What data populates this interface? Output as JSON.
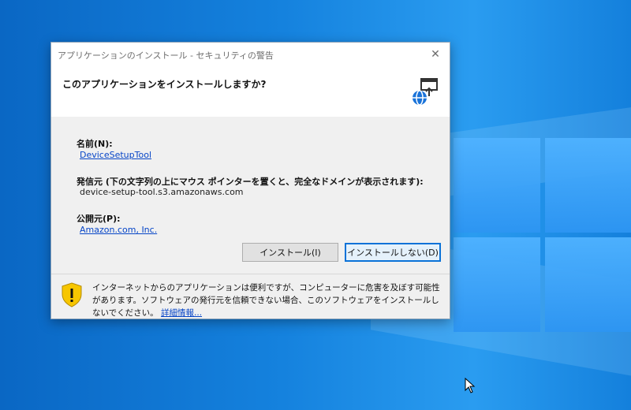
{
  "dialog": {
    "title": "アプリケーションのインストール - セキュリティの警告",
    "close_glyph": "✕",
    "question": "このアプリケーションをインストールしますか?",
    "name_label": "名前(N):",
    "name_value": "DeviceSetupTool",
    "source_label": "発信元 (下の文字列の上にマウス ポインターを置くと、完全なドメインが表示されます):",
    "source_value": "device-setup-tool.s3.amazonaws.com",
    "publisher_label": "公開元(P):",
    "publisher_value": "Amazon.com, Inc.",
    "install_button": "インストール(I)",
    "dont_install_button": "インストールしない(D)",
    "warning_text": "インターネットからのアプリケーションは便利ですが、コンピューターに危害を及ぼす可能性があります。ソフトウェアの発行元を信頼できない場合、このソフトウェアをインストールしないでください。",
    "more_info_link": "詳細情報..."
  },
  "colors": {
    "desktop_blue": "#1582de",
    "link_blue": "#0645c7",
    "default_button_border": "#0a72d8",
    "shield_yellow": "#f7c600"
  },
  "icons": {
    "install_icon": "globe-install-icon",
    "warning_icon": "shield-warning-icon",
    "close_icon": "close-icon"
  }
}
